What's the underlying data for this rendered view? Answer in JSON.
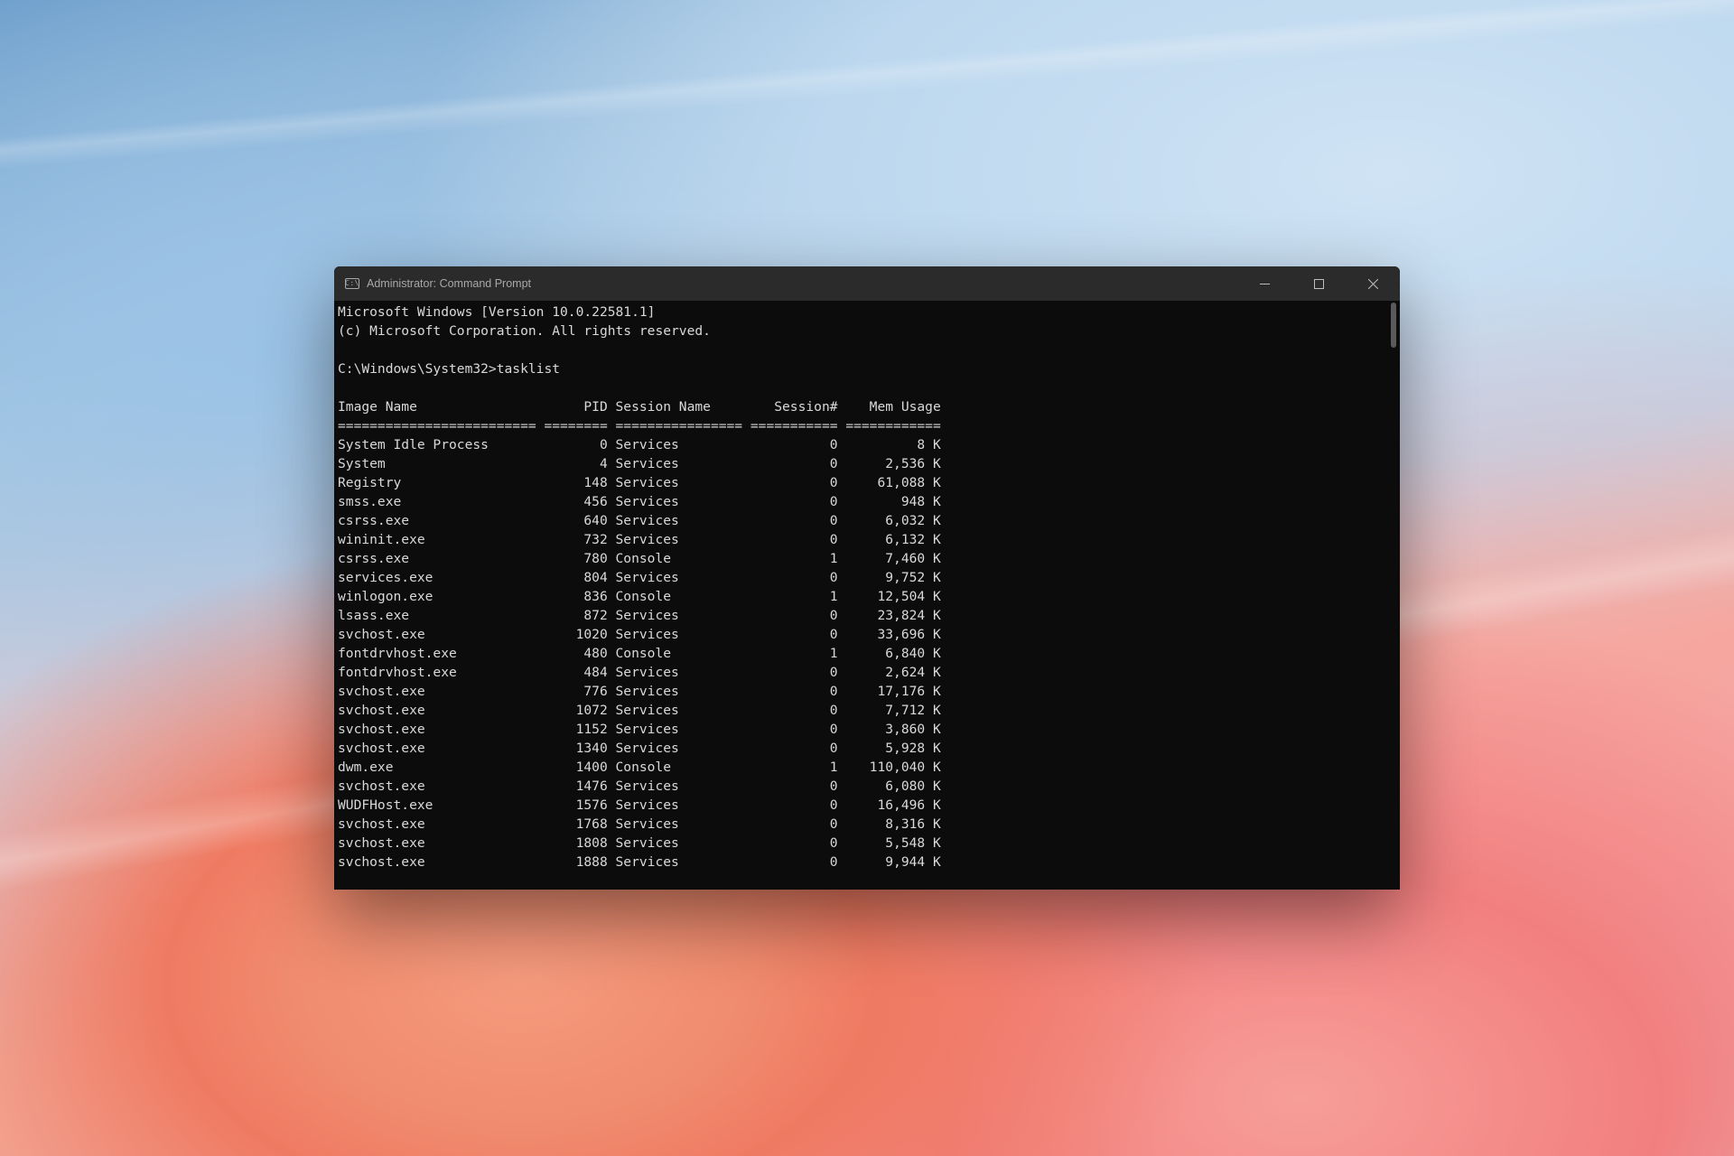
{
  "window": {
    "title": "Administrator: Command Prompt",
    "icon_glyph": "C:\\"
  },
  "terminal": {
    "banner_line1": "Microsoft Windows [Version 10.0.22581.1]",
    "banner_line2": "(c) Microsoft Corporation. All rights reserved.",
    "prompt": "C:\\Windows\\System32>",
    "command": "tasklist",
    "columns": {
      "image_name": "Image Name",
      "pid": "PID",
      "session_name": "Session Name",
      "session_num": "Session#",
      "mem_usage": "Mem Usage"
    },
    "separator": {
      "image_name": "=========================",
      "pid": "========",
      "session_name": "================",
      "session_num": "===========",
      "mem_usage": "============"
    },
    "rows": [
      {
        "image_name": "System Idle Process",
        "pid": "0",
        "session_name": "Services",
        "session_num": "0",
        "mem_usage": "8 K"
      },
      {
        "image_name": "System",
        "pid": "4",
        "session_name": "Services",
        "session_num": "0",
        "mem_usage": "2,536 K"
      },
      {
        "image_name": "Registry",
        "pid": "148",
        "session_name": "Services",
        "session_num": "0",
        "mem_usage": "61,088 K"
      },
      {
        "image_name": "smss.exe",
        "pid": "456",
        "session_name": "Services",
        "session_num": "0",
        "mem_usage": "948 K"
      },
      {
        "image_name": "csrss.exe",
        "pid": "640",
        "session_name": "Services",
        "session_num": "0",
        "mem_usage": "6,032 K"
      },
      {
        "image_name": "wininit.exe",
        "pid": "732",
        "session_name": "Services",
        "session_num": "0",
        "mem_usage": "6,132 K"
      },
      {
        "image_name": "csrss.exe",
        "pid": "780",
        "session_name": "Console",
        "session_num": "1",
        "mem_usage": "7,460 K"
      },
      {
        "image_name": "services.exe",
        "pid": "804",
        "session_name": "Services",
        "session_num": "0",
        "mem_usage": "9,752 K"
      },
      {
        "image_name": "winlogon.exe",
        "pid": "836",
        "session_name": "Console",
        "session_num": "1",
        "mem_usage": "12,504 K"
      },
      {
        "image_name": "lsass.exe",
        "pid": "872",
        "session_name": "Services",
        "session_num": "0",
        "mem_usage": "23,824 K"
      },
      {
        "image_name": "svchost.exe",
        "pid": "1020",
        "session_name": "Services",
        "session_num": "0",
        "mem_usage": "33,696 K"
      },
      {
        "image_name": "fontdrvhost.exe",
        "pid": "480",
        "session_name": "Console",
        "session_num": "1",
        "mem_usage": "6,840 K"
      },
      {
        "image_name": "fontdrvhost.exe",
        "pid": "484",
        "session_name": "Services",
        "session_num": "0",
        "mem_usage": "2,624 K"
      },
      {
        "image_name": "svchost.exe",
        "pid": "776",
        "session_name": "Services",
        "session_num": "0",
        "mem_usage": "17,176 K"
      },
      {
        "image_name": "svchost.exe",
        "pid": "1072",
        "session_name": "Services",
        "session_num": "0",
        "mem_usage": "7,712 K"
      },
      {
        "image_name": "svchost.exe",
        "pid": "1152",
        "session_name": "Services",
        "session_num": "0",
        "mem_usage": "3,860 K"
      },
      {
        "image_name": "svchost.exe",
        "pid": "1340",
        "session_name": "Services",
        "session_num": "0",
        "mem_usage": "5,928 K"
      },
      {
        "image_name": "dwm.exe",
        "pid": "1400",
        "session_name": "Console",
        "session_num": "1",
        "mem_usage": "110,040 K"
      },
      {
        "image_name": "svchost.exe",
        "pid": "1476",
        "session_name": "Services",
        "session_num": "0",
        "mem_usage": "6,080 K"
      },
      {
        "image_name": "WUDFHost.exe",
        "pid": "1576",
        "session_name": "Services",
        "session_num": "0",
        "mem_usage": "16,496 K"
      },
      {
        "image_name": "svchost.exe",
        "pid": "1768",
        "session_name": "Services",
        "session_num": "0",
        "mem_usage": "8,316 K"
      },
      {
        "image_name": "svchost.exe",
        "pid": "1808",
        "session_name": "Services",
        "session_num": "0",
        "mem_usage": "5,548 K"
      },
      {
        "image_name": "svchost.exe",
        "pid": "1888",
        "session_name": "Services",
        "session_num": "0",
        "mem_usage": "9,944 K"
      }
    ]
  }
}
